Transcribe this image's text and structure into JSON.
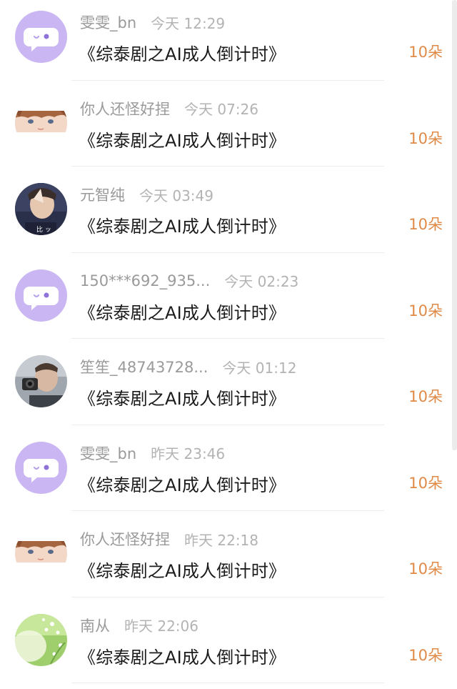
{
  "gifts": [
    {
      "user": "雯雯_bn",
      "time": "今天 12:29",
      "title": "《综泰剧之AI成人倒计时》",
      "amount": "10朵",
      "avatar": "chat-bubble-purple"
    },
    {
      "user": "你人还怪好捏",
      "time": "今天 07:26",
      "title": "《综泰剧之AI成人倒计时》",
      "amount": "10朵",
      "avatar": "anime-boy"
    },
    {
      "user": "元智纯",
      "time": "今天 03:49",
      "title": "《综泰剧之AI成人倒计时》",
      "amount": "10朵",
      "avatar": "photo-person-dark"
    },
    {
      "user": "150***692_935...",
      "time": "今天 02:23",
      "title": "《综泰剧之AI成人倒计时》",
      "amount": "10朵",
      "avatar": "chat-bubble-purple"
    },
    {
      "user": "笙笙_48743728...",
      "time": "今天 01:12",
      "title": "《综泰剧之AI成人倒计时》",
      "amount": "10朵",
      "avatar": "photo-person-camera"
    },
    {
      "user": "雯雯_bn",
      "time": "昨天 23:46",
      "title": "《综泰剧之AI成人倒计时》",
      "amount": "10朵",
      "avatar": "chat-bubble-purple"
    },
    {
      "user": "你人还怪好捏",
      "time": "昨天 22:18",
      "title": "《综泰剧之AI成人倒计时》",
      "amount": "10朵",
      "avatar": "anime-boy"
    },
    {
      "user": "南从",
      "time": "昨天 22:06",
      "title": "《综泰剧之AI成人倒计时》",
      "amount": "10朵",
      "avatar": "green-flowers"
    }
  ],
  "colors": {
    "amount": "#e08a48",
    "avatar_purple": "#c9b6f2",
    "divider": "#ececec"
  }
}
